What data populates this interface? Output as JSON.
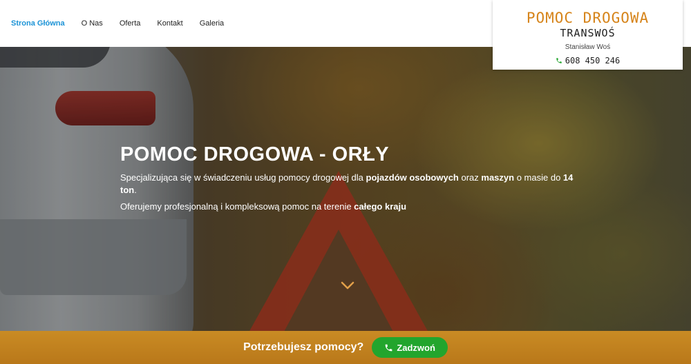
{
  "nav": {
    "items": [
      {
        "label": "Strona Główna",
        "active": true
      },
      {
        "label": "O Nas",
        "active": false
      },
      {
        "label": "Oferta",
        "active": false
      },
      {
        "label": "Kontakt",
        "active": false
      },
      {
        "label": "Galeria",
        "active": false
      }
    ]
  },
  "logo": {
    "title": "POMOC DROGOWA",
    "subtitle": "TRANSWOŚ",
    "owner": "Stanisław Woś",
    "phone": "608 450 246",
    "phone_icon": "phone-icon"
  },
  "hero": {
    "title": "POMOC DROGOWA - ORŁY",
    "line1": {
      "p1": "Specjalizująca się w świadczeniu usług pomocy drogowej dla ",
      "b1": "pojazdów osobowych",
      "p2": " oraz ",
      "b2": "maszyn",
      "p3": " o masie do ",
      "b3": "14 ton",
      "p4": "."
    },
    "line2": {
      "p1": "Oferujemy profesjonalną i kompleksową pomoc na terenie ",
      "b1": "całego kraju"
    },
    "scroll_icon": "chevron-down-icon"
  },
  "cta": {
    "text": "Potrzebujesz pomocy?",
    "button_label": "Zadzwoń",
    "button_icon": "phone-icon"
  },
  "colors": {
    "nav_active": "#1c93d6",
    "logo_accent": "#d6841a",
    "cta_bar": "#c98b24",
    "cta_button": "#22a52d"
  }
}
